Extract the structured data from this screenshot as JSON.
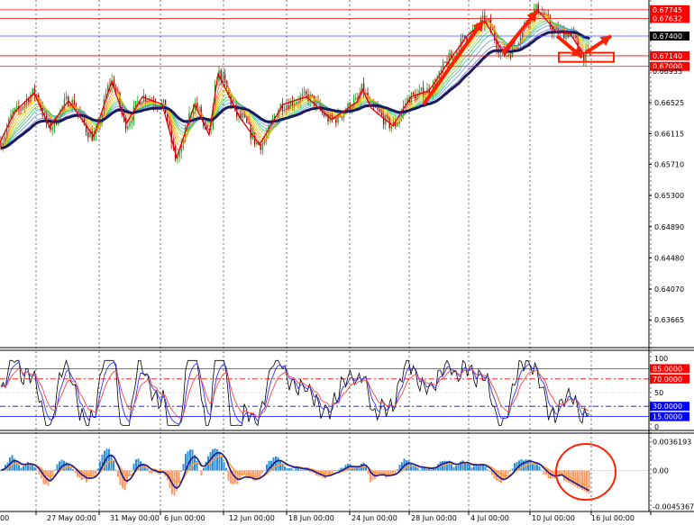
{
  "chart_data": [
    {
      "type": "candlestick",
      "panel": "price",
      "ylim": [
        0.633,
        0.6785
      ],
      "y_ticks": [
        0.66525,
        0.66115,
        0.6571,
        0.653,
        0.6489,
        0.6448,
        0.6407,
        0.63665
      ],
      "y_tick_labels": [
        "0.66525",
        "0.66115",
        "0.65710",
        "0.65300",
        "0.64890",
        "0.64480",
        "0.64070",
        "0.63665"
      ],
      "price_levels": [
        {
          "value": 0.67745,
          "label": "0.67745",
          "color": "#ff0000"
        },
        {
          "value": 0.67632,
          "label": "0.67632",
          "color": "#ff0000"
        },
        {
          "value": 0.674,
          "label": "0.67400",
          "color": "#000000"
        },
        {
          "value": 0.6714,
          "label": "0.67140",
          "color": "#ff0000"
        },
        {
          "value": 0.67,
          "label": "0.67000",
          "color": "#ff0000"
        },
        {
          "value": 0.66935,
          "label": "0.66935",
          "color": "none"
        }
      ],
      "x_labels": [
        "00",
        "27 May 00:00",
        "31 May 00:00",
        "6 Jun 00:00",
        "12 Jun 00:00",
        "18 Jun 00:00",
        "24 Jun 00:00",
        "28 Jun 00:00",
        "4 Jul 00:00",
        "10 Jul 00:00",
        "16 Jul 00:00"
      ],
      "zigzag": [
        [
          0,
          0.66
        ],
        [
          16,
          0.664
        ],
        [
          38,
          0.6665
        ],
        [
          55,
          0.662
        ],
        [
          76,
          0.6655
        ],
        [
          104,
          0.6608
        ],
        [
          124,
          0.668
        ],
        [
          140,
          0.6625
        ],
        [
          158,
          0.666
        ],
        [
          180,
          0.665
        ],
        [
          196,
          0.658
        ],
        [
          216,
          0.665
        ],
        [
          232,
          0.661
        ],
        [
          242,
          0.669
        ],
        [
          266,
          0.6633
        ],
        [
          288,
          0.6597
        ],
        [
          314,
          0.665
        ],
        [
          340,
          0.666
        ],
        [
          368,
          0.663
        ],
        [
          396,
          0.6653
        ],
        [
          402,
          0.667
        ],
        [
          412,
          0.6645
        ],
        [
          436,
          0.6622
        ],
        [
          456,
          0.666
        ],
        [
          476,
          0.6668
        ],
        [
          500,
          0.671
        ],
        [
          518,
          0.674
        ],
        [
          538,
          0.676
        ],
        [
          560,
          0.6715
        ],
        [
          596,
          0.6775
        ],
        [
          618,
          0.6745
        ],
        [
          632,
          0.6744
        ],
        [
          648,
          0.6715
        ]
      ],
      "arrows": [
        [
          470,
          0.665,
          536,
          0.676
        ],
        [
          558,
          0.6718,
          596,
          0.6773
        ],
        [
          618,
          0.674,
          646,
          0.6712
        ],
        [
          650,
          0.6718,
          678,
          0.674
        ]
      ],
      "highlight_box": {
        "x": [
          620,
          681
        ],
        "y": [
          0.6706,
          0.6718
        ]
      }
    },
    {
      "type": "line",
      "panel": "oscillator",
      "ylim": [
        0,
        100
      ],
      "y_ticks": [
        100,
        50,
        0
      ],
      "y_tick_labels": [
        "100",
        "50",
        "0"
      ],
      "levels": [
        {
          "value": 85,
          "label": "85.0000",
          "color": "#ff0000"
        },
        {
          "value": 70,
          "label": "70.0000",
          "color": "#ff0000"
        },
        {
          "value": 30,
          "label": "30.0000",
          "color": "#0000ff"
        },
        {
          "value": 15,
          "label": "15.0000",
          "color": "#0000ff"
        }
      ]
    },
    {
      "type": "histogram",
      "panel": "macd",
      "ylim": [
        -0.0045,
        0.0037
      ],
      "y_ticks": [
        0.0036193,
        0,
        -0.0045367
      ],
      "y_tick_labels": [
        "0.0036193",
        "0.00",
        "-0.0045367"
      ]
    }
  ]
}
